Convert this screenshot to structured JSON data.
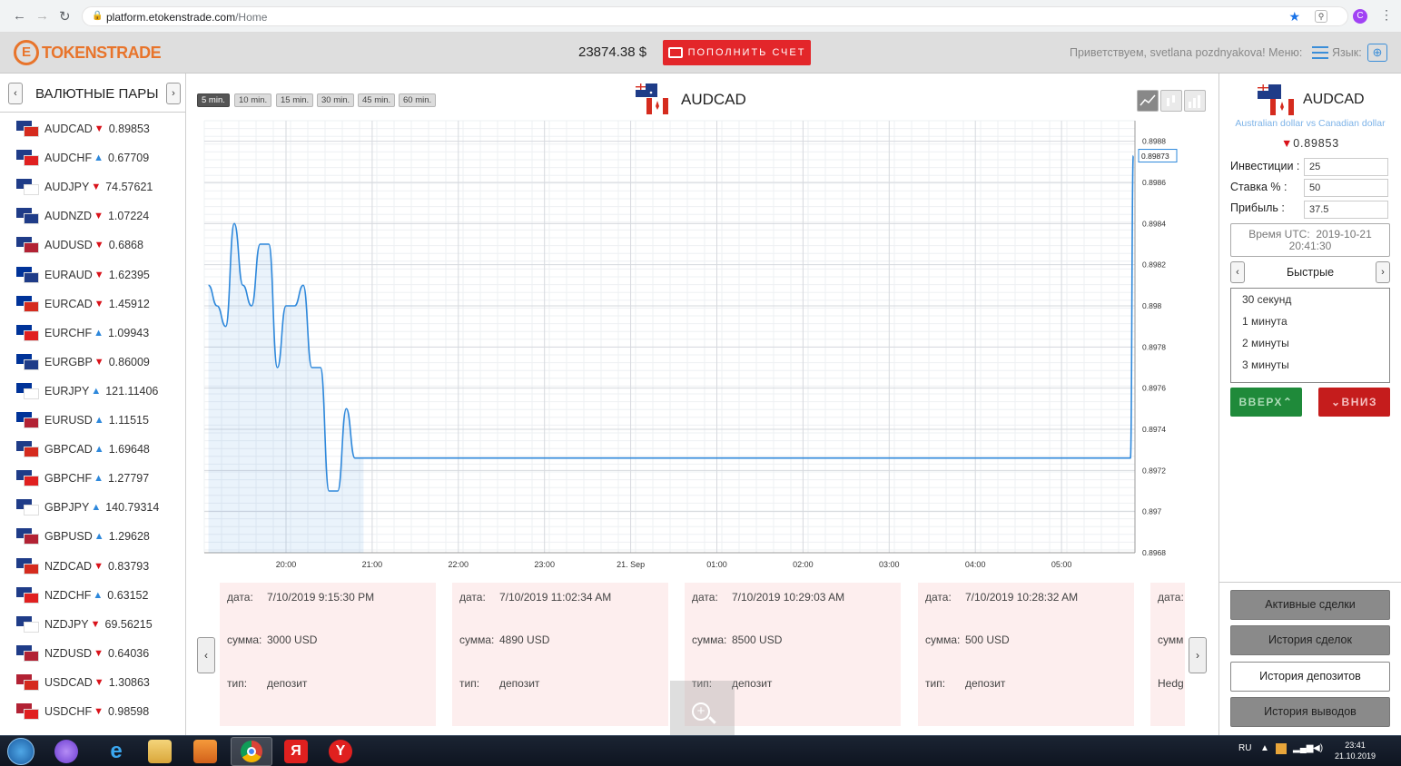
{
  "browser": {
    "url_host": "platform.etokenstrade.com",
    "url_path": "/Home",
    "profile_initial": "C"
  },
  "header": {
    "logo_text": "TOKENSTRADE",
    "balance": "23874.38 $",
    "deposit_label": "ПОПОЛНИТЬ СЧЕТ",
    "greeting": "Приветствуем, svetlana pozdnyakova! Меню:",
    "lang_label": "Язык:"
  },
  "sidebar": {
    "title": "ВАЛЮТНЫЕ ПАРЫ",
    "pairs": [
      {
        "name": "AUDCAD",
        "dir": "down",
        "value": "0.89853",
        "c1": "#1f3c88",
        "c2": "#d52b1e"
      },
      {
        "name": "AUDCHF",
        "dir": "up",
        "value": "0.67709",
        "c1": "#1f3c88",
        "c2": "#e02020"
      },
      {
        "name": "AUDJPY",
        "dir": "down",
        "value": "74.57621",
        "c1": "#1f3c88",
        "c2": "#ffffff"
      },
      {
        "name": "AUDNZD",
        "dir": "down",
        "value": "1.07224",
        "c1": "#1f3c88",
        "c2": "#1f3c88"
      },
      {
        "name": "AUDUSD",
        "dir": "down",
        "value": "0.6868",
        "c1": "#1f3c88",
        "c2": "#b22234"
      },
      {
        "name": "EURAUD",
        "dir": "down",
        "value": "1.62395",
        "c1": "#003399",
        "c2": "#1f3c88"
      },
      {
        "name": "EURCAD",
        "dir": "down",
        "value": "1.45912",
        "c1": "#003399",
        "c2": "#d52b1e"
      },
      {
        "name": "EURCHF",
        "dir": "up",
        "value": "1.09943",
        "c1": "#003399",
        "c2": "#e02020"
      },
      {
        "name": "EURGBP",
        "dir": "down",
        "value": "0.86009",
        "c1": "#003399",
        "c2": "#1f3c88"
      },
      {
        "name": "EURJPY",
        "dir": "up",
        "value": "121.11406",
        "c1": "#003399",
        "c2": "#ffffff"
      },
      {
        "name": "EURUSD",
        "dir": "up",
        "value": "1.11515",
        "c1": "#003399",
        "c2": "#b22234"
      },
      {
        "name": "GBPCAD",
        "dir": "up",
        "value": "1.69648",
        "c1": "#1f3c88",
        "c2": "#d52b1e"
      },
      {
        "name": "GBPCHF",
        "dir": "up",
        "value": "1.27797",
        "c1": "#1f3c88",
        "c2": "#e02020"
      },
      {
        "name": "GBPJPY",
        "dir": "up",
        "value": "140.79314",
        "c1": "#1f3c88",
        "c2": "#ffffff"
      },
      {
        "name": "GBPUSD",
        "dir": "up",
        "value": "1.29628",
        "c1": "#1f3c88",
        "c2": "#b22234"
      },
      {
        "name": "NZDCAD",
        "dir": "down",
        "value": "0.83793",
        "c1": "#1f3c88",
        "c2": "#d52b1e"
      },
      {
        "name": "NZDCHF",
        "dir": "up",
        "value": "0.63152",
        "c1": "#1f3c88",
        "c2": "#e02020"
      },
      {
        "name": "NZDJPY",
        "dir": "down",
        "value": "69.56215",
        "c1": "#1f3c88",
        "c2": "#ffffff"
      },
      {
        "name": "NZDUSD",
        "dir": "down",
        "value": "0.64036",
        "c1": "#1f3c88",
        "c2": "#b22234"
      },
      {
        "name": "USDCAD",
        "dir": "down",
        "value": "1.30863",
        "c1": "#b22234",
        "c2": "#d52b1e"
      },
      {
        "name": "USDCHF",
        "dir": "down",
        "value": "0.98598",
        "c1": "#b22234",
        "c2": "#e02020"
      }
    ]
  },
  "chart": {
    "timeframes": [
      "5 min.",
      "10 min.",
      "15 min.",
      "30 min.",
      "45 min.",
      "60 min."
    ],
    "active_timeframe": "5 min.",
    "pair": "AUDCAD"
  },
  "chart_data": {
    "type": "area",
    "title": "AUDCAD",
    "x_ticks": [
      "20:00",
      "21:00",
      "22:00",
      "23:00",
      "21. Sep",
      "01:00",
      "02:00",
      "03:00",
      "04:00",
      "05:00"
    ],
    "y_ticks": [
      "0.8988",
      "0.8986",
      "0.8984",
      "0.8982",
      "0.898",
      "0.8978",
      "0.8976",
      "0.8974",
      "0.8972",
      "0.897",
      "0.8968"
    ],
    "ylim": [
      0.8968,
      0.8989
    ],
    "current_value": "0.89873",
    "series": [
      {
        "x": [
          "19:06",
          "19:12",
          "19:18",
          "19:24",
          "19:30",
          "19:36",
          "19:42",
          "19:48",
          "19:54",
          "20:00",
          "20:06",
          "20:12",
          "20:18",
          "20:24",
          "20:30",
          "20:36",
          "20:42",
          "20:48",
          "20:54",
          "21:00",
          "21:06",
          "21:12",
          "22:00",
          "23:00",
          "00:00",
          "01:00",
          "02:00",
          "03:00",
          "04:00",
          "05:00",
          "05:48",
          "05:50"
        ],
        "values": [
          0.8981,
          0.898,
          0.8979,
          0.8984,
          0.8981,
          0.898,
          0.8983,
          0.8983,
          0.8977,
          0.898,
          0.898,
          0.8981,
          0.8977,
          0.8977,
          0.8971,
          0.8971,
          0.8975,
          0.89726,
          0.89726,
          0.89726,
          0.89726,
          0.89726,
          0.89726,
          0.89726,
          0.89726,
          0.89726,
          0.89726,
          0.89726,
          0.89726,
          0.89726,
          0.89726,
          0.89873
        ]
      }
    ],
    "grid": true
  },
  "cards": [
    {
      "date_label": "дата:",
      "date": "7/10/2019 9:15:30 PM",
      "sum_label": "сумма:",
      "sum": "3000 USD",
      "type_label": "тип:",
      "type": "депозит"
    },
    {
      "date_label": "дата:",
      "date": "7/10/2019 11:02:34 AM",
      "sum_label": "сумма:",
      "sum": "4890 USD",
      "type_label": "тип:",
      "type": "депозит"
    },
    {
      "date_label": "дата:",
      "date": "7/10/2019 10:29:03 AM",
      "sum_label": "сумма:",
      "sum": "8500 USD",
      "type_label": "тип:",
      "type": "депозит"
    },
    {
      "date_label": "дата:",
      "date": "7/10/2019 10:28:32 AM",
      "sum_label": "сумма:",
      "sum": "500 USD",
      "type_label": "тип:",
      "type": "депозит"
    },
    {
      "date_label": "дата:",
      "date": "",
      "sum_label": "сумм",
      "sum": "",
      "type_label": "Hedg",
      "type": ""
    }
  ],
  "right": {
    "pair": "AUDCAD",
    "subtitle": "Australian dollar vs Canadian dollar",
    "rate": "0.89853",
    "invest_label": "Инвестиции :",
    "invest_value": "25",
    "rate_label": "Ставка % :",
    "rate_value": "50",
    "profit_label": "Прибыль :",
    "profit_value": "37.5",
    "time_label": "Время UTC:",
    "time_date": "2019-10-21",
    "time_clock": "20:41:30",
    "mode": "Быстрые",
    "options": [
      "30 секунд",
      "1 минута",
      "2 минуты",
      "3 минуты"
    ],
    "up_label": "ВВЕРХ",
    "down_label": "ВНИЗ",
    "actions": [
      "Активные сделки",
      "История сделок",
      "История депозитов",
      "История выводов"
    ]
  },
  "taskbar": {
    "lang": "RU",
    "time": "23:41",
    "date": "21.10.2019"
  },
  "colors": {
    "accent_blue": "#2e88db",
    "brand_orange": "#e8742b",
    "down_red": "#d9121a",
    "up_green": "#1f8a3a"
  }
}
